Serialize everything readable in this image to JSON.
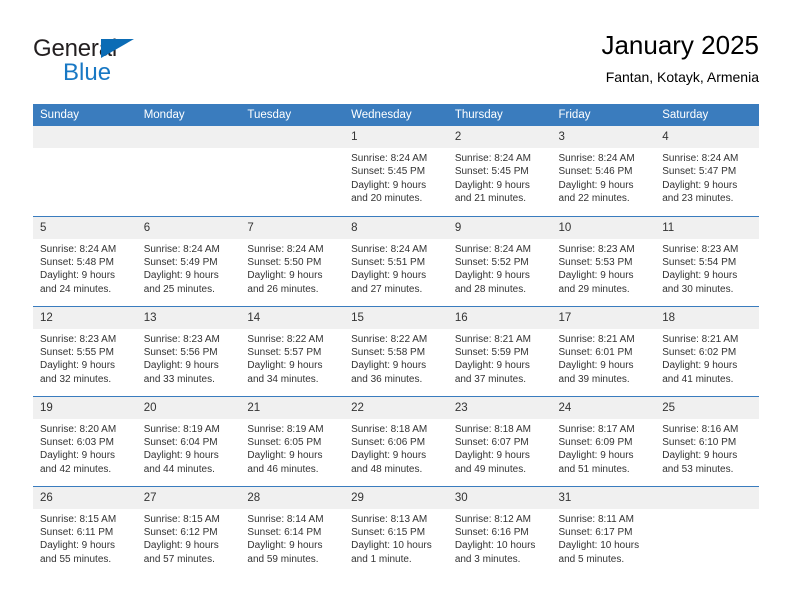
{
  "logo": {
    "word_one": "General",
    "word_two": "Blue",
    "triangle_color": "#0b6cb5",
    "blue_color": "#1878c4"
  },
  "header": {
    "title": "January 2025",
    "subtitle": "Fantan, Kotayk, Armenia"
  },
  "theme": {
    "header_row_bg": "#3a7cbe",
    "day_strip_bg": "#f0f0f0",
    "text_color": "#333333"
  },
  "weekday_headers": [
    "Sunday",
    "Monday",
    "Tuesday",
    "Wednesday",
    "Thursday",
    "Friday",
    "Saturday"
  ],
  "weeks": [
    [
      {
        "day": "",
        "sunrise": "",
        "sunset": "",
        "daylight_line1": "",
        "daylight_line2": ""
      },
      {
        "day": "",
        "sunrise": "",
        "sunset": "",
        "daylight_line1": "",
        "daylight_line2": ""
      },
      {
        "day": "",
        "sunrise": "",
        "sunset": "",
        "daylight_line1": "",
        "daylight_line2": ""
      },
      {
        "day": "1",
        "sunrise": "Sunrise: 8:24 AM",
        "sunset": "Sunset: 5:45 PM",
        "daylight_line1": "Daylight: 9 hours",
        "daylight_line2": "and 20 minutes."
      },
      {
        "day": "2",
        "sunrise": "Sunrise: 8:24 AM",
        "sunset": "Sunset: 5:45 PM",
        "daylight_line1": "Daylight: 9 hours",
        "daylight_line2": "and 21 minutes."
      },
      {
        "day": "3",
        "sunrise": "Sunrise: 8:24 AM",
        "sunset": "Sunset: 5:46 PM",
        "daylight_line1": "Daylight: 9 hours",
        "daylight_line2": "and 22 minutes."
      },
      {
        "day": "4",
        "sunrise": "Sunrise: 8:24 AM",
        "sunset": "Sunset: 5:47 PM",
        "daylight_line1": "Daylight: 9 hours",
        "daylight_line2": "and 23 minutes."
      }
    ],
    [
      {
        "day": "5",
        "sunrise": "Sunrise: 8:24 AM",
        "sunset": "Sunset: 5:48 PM",
        "daylight_line1": "Daylight: 9 hours",
        "daylight_line2": "and 24 minutes."
      },
      {
        "day": "6",
        "sunrise": "Sunrise: 8:24 AM",
        "sunset": "Sunset: 5:49 PM",
        "daylight_line1": "Daylight: 9 hours",
        "daylight_line2": "and 25 minutes."
      },
      {
        "day": "7",
        "sunrise": "Sunrise: 8:24 AM",
        "sunset": "Sunset: 5:50 PM",
        "daylight_line1": "Daylight: 9 hours",
        "daylight_line2": "and 26 minutes."
      },
      {
        "day": "8",
        "sunrise": "Sunrise: 8:24 AM",
        "sunset": "Sunset: 5:51 PM",
        "daylight_line1": "Daylight: 9 hours",
        "daylight_line2": "and 27 minutes."
      },
      {
        "day": "9",
        "sunrise": "Sunrise: 8:24 AM",
        "sunset": "Sunset: 5:52 PM",
        "daylight_line1": "Daylight: 9 hours",
        "daylight_line2": "and 28 minutes."
      },
      {
        "day": "10",
        "sunrise": "Sunrise: 8:23 AM",
        "sunset": "Sunset: 5:53 PM",
        "daylight_line1": "Daylight: 9 hours",
        "daylight_line2": "and 29 minutes."
      },
      {
        "day": "11",
        "sunrise": "Sunrise: 8:23 AM",
        "sunset": "Sunset: 5:54 PM",
        "daylight_line1": "Daylight: 9 hours",
        "daylight_line2": "and 30 minutes."
      }
    ],
    [
      {
        "day": "12",
        "sunrise": "Sunrise: 8:23 AM",
        "sunset": "Sunset: 5:55 PM",
        "daylight_line1": "Daylight: 9 hours",
        "daylight_line2": "and 32 minutes."
      },
      {
        "day": "13",
        "sunrise": "Sunrise: 8:23 AM",
        "sunset": "Sunset: 5:56 PM",
        "daylight_line1": "Daylight: 9 hours",
        "daylight_line2": "and 33 minutes."
      },
      {
        "day": "14",
        "sunrise": "Sunrise: 8:22 AM",
        "sunset": "Sunset: 5:57 PM",
        "daylight_line1": "Daylight: 9 hours",
        "daylight_line2": "and 34 minutes."
      },
      {
        "day": "15",
        "sunrise": "Sunrise: 8:22 AM",
        "sunset": "Sunset: 5:58 PM",
        "daylight_line1": "Daylight: 9 hours",
        "daylight_line2": "and 36 minutes."
      },
      {
        "day": "16",
        "sunrise": "Sunrise: 8:21 AM",
        "sunset": "Sunset: 5:59 PM",
        "daylight_line1": "Daylight: 9 hours",
        "daylight_line2": "and 37 minutes."
      },
      {
        "day": "17",
        "sunrise": "Sunrise: 8:21 AM",
        "sunset": "Sunset: 6:01 PM",
        "daylight_line1": "Daylight: 9 hours",
        "daylight_line2": "and 39 minutes."
      },
      {
        "day": "18",
        "sunrise": "Sunrise: 8:21 AM",
        "sunset": "Sunset: 6:02 PM",
        "daylight_line1": "Daylight: 9 hours",
        "daylight_line2": "and 41 minutes."
      }
    ],
    [
      {
        "day": "19",
        "sunrise": "Sunrise: 8:20 AM",
        "sunset": "Sunset: 6:03 PM",
        "daylight_line1": "Daylight: 9 hours",
        "daylight_line2": "and 42 minutes."
      },
      {
        "day": "20",
        "sunrise": "Sunrise: 8:19 AM",
        "sunset": "Sunset: 6:04 PM",
        "daylight_line1": "Daylight: 9 hours",
        "daylight_line2": "and 44 minutes."
      },
      {
        "day": "21",
        "sunrise": "Sunrise: 8:19 AM",
        "sunset": "Sunset: 6:05 PM",
        "daylight_line1": "Daylight: 9 hours",
        "daylight_line2": "and 46 minutes."
      },
      {
        "day": "22",
        "sunrise": "Sunrise: 8:18 AM",
        "sunset": "Sunset: 6:06 PM",
        "daylight_line1": "Daylight: 9 hours",
        "daylight_line2": "and 48 minutes."
      },
      {
        "day": "23",
        "sunrise": "Sunrise: 8:18 AM",
        "sunset": "Sunset: 6:07 PM",
        "daylight_line1": "Daylight: 9 hours",
        "daylight_line2": "and 49 minutes."
      },
      {
        "day": "24",
        "sunrise": "Sunrise: 8:17 AM",
        "sunset": "Sunset: 6:09 PM",
        "daylight_line1": "Daylight: 9 hours",
        "daylight_line2": "and 51 minutes."
      },
      {
        "day": "25",
        "sunrise": "Sunrise: 8:16 AM",
        "sunset": "Sunset: 6:10 PM",
        "daylight_line1": "Daylight: 9 hours",
        "daylight_line2": "and 53 minutes."
      }
    ],
    [
      {
        "day": "26",
        "sunrise": "Sunrise: 8:15 AM",
        "sunset": "Sunset: 6:11 PM",
        "daylight_line1": "Daylight: 9 hours",
        "daylight_line2": "and 55 minutes."
      },
      {
        "day": "27",
        "sunrise": "Sunrise: 8:15 AM",
        "sunset": "Sunset: 6:12 PM",
        "daylight_line1": "Daylight: 9 hours",
        "daylight_line2": "and 57 minutes."
      },
      {
        "day": "28",
        "sunrise": "Sunrise: 8:14 AM",
        "sunset": "Sunset: 6:14 PM",
        "daylight_line1": "Daylight: 9 hours",
        "daylight_line2": "and 59 minutes."
      },
      {
        "day": "29",
        "sunrise": "Sunrise: 8:13 AM",
        "sunset": "Sunset: 6:15 PM",
        "daylight_line1": "Daylight: 10 hours",
        "daylight_line2": "and 1 minute."
      },
      {
        "day": "30",
        "sunrise": "Sunrise: 8:12 AM",
        "sunset": "Sunset: 6:16 PM",
        "daylight_line1": "Daylight: 10 hours",
        "daylight_line2": "and 3 minutes."
      },
      {
        "day": "31",
        "sunrise": "Sunrise: 8:11 AM",
        "sunset": "Sunset: 6:17 PM",
        "daylight_line1": "Daylight: 10 hours",
        "daylight_line2": "and 5 minutes."
      },
      {
        "day": "",
        "sunrise": "",
        "sunset": "",
        "daylight_line1": "",
        "daylight_line2": ""
      }
    ]
  ]
}
